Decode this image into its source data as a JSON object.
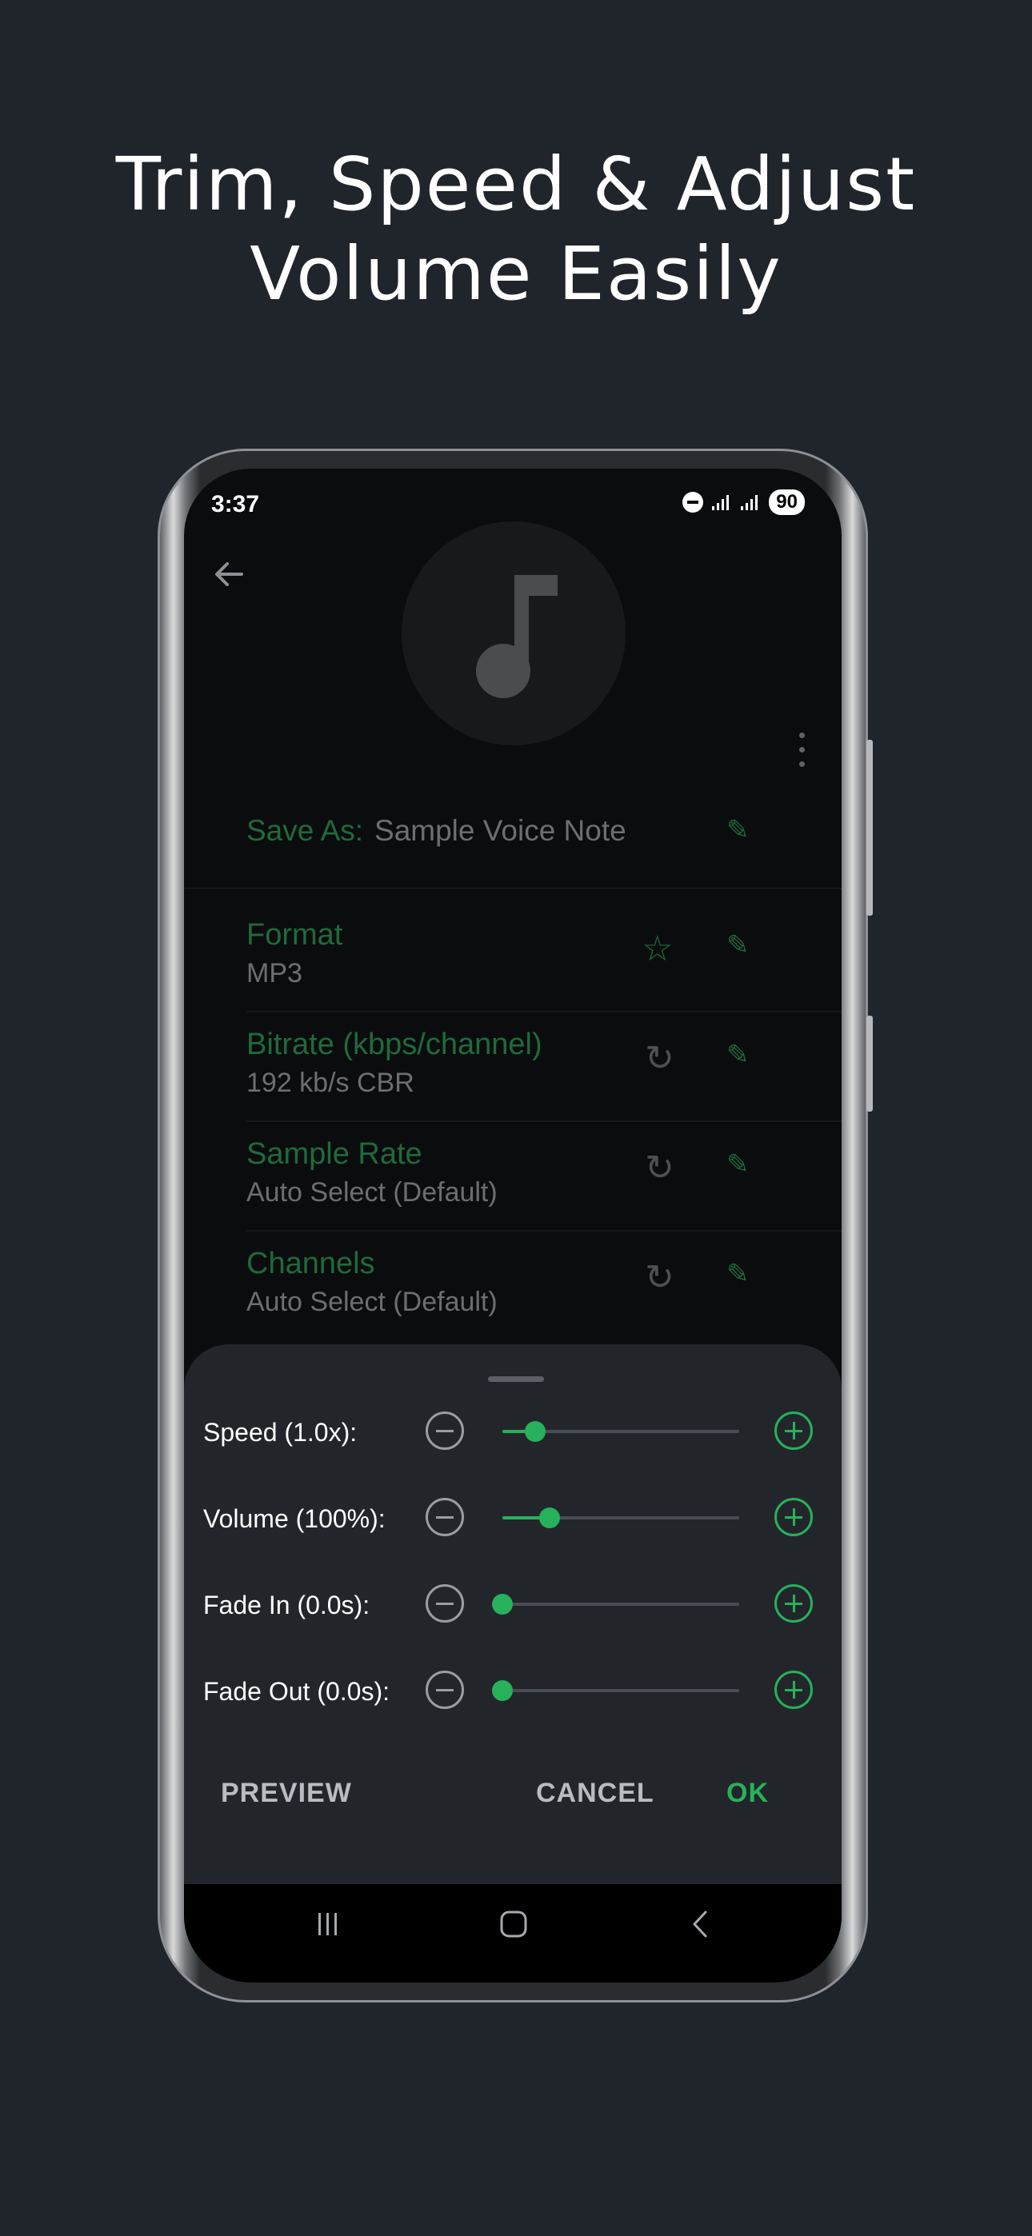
{
  "headline": {
    "line1": "Trim, Speed & Adjust",
    "line2": "Volume Easily"
  },
  "status_bar": {
    "time": "3:37",
    "battery": "90"
  },
  "save_as": {
    "label": "Save As:",
    "value": "Sample Voice Note"
  },
  "settings": [
    {
      "title": "Format",
      "value": "MP3",
      "left_icon": "star-outline-icon"
    },
    {
      "title": "Bitrate (kbps/channel)",
      "value": "192 kb/s CBR",
      "left_icon": "reset-icon"
    },
    {
      "title": "Sample Rate",
      "value": "Auto Select (Default)",
      "left_icon": "reset-icon"
    },
    {
      "title": "Channels",
      "value": "Auto Select (Default)",
      "left_icon": "reset-icon"
    }
  ],
  "sheet": {
    "sliders": [
      {
        "label": "Speed (1.0x):",
        "position": 0.14
      },
      {
        "label": "Volume (100%):",
        "position": 0.2
      },
      {
        "label": "Fade In (0.0s):",
        "position": 0.0
      },
      {
        "label": "Fade Out (0.0s):",
        "position": 0.0
      }
    ],
    "actions": {
      "preview": "PREVIEW",
      "cancel": "CANCEL",
      "ok": "OK"
    }
  },
  "colors": {
    "accent": "#27b15a",
    "dim_accent": "#1f6a3b",
    "background": "#20242b",
    "sheet": "#22262b"
  }
}
